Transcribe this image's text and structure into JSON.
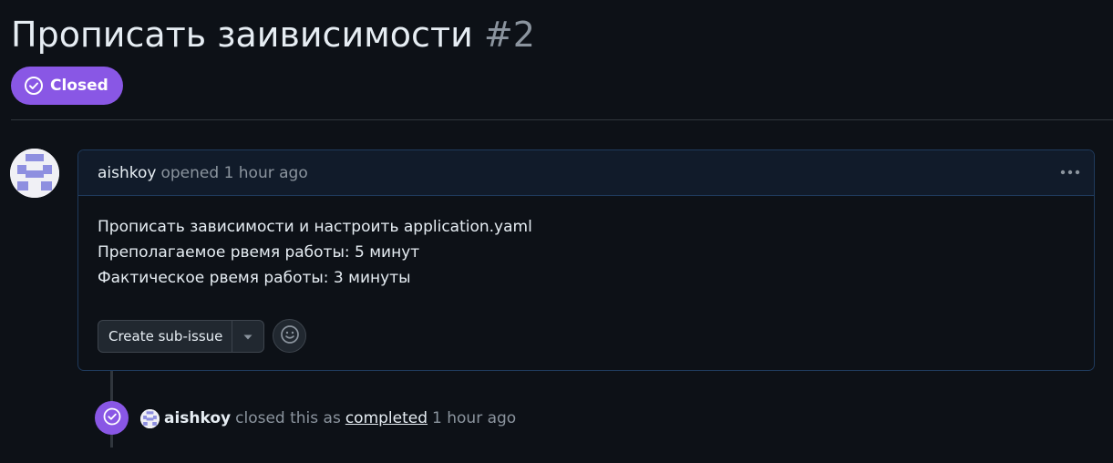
{
  "issue": {
    "title": "Прописать заивисимости",
    "number": "#2",
    "state": "Closed",
    "state_icon": "check-circle-icon",
    "state_color": "#8957e5"
  },
  "comment": {
    "author": "aishkoy",
    "meta": "opened 1 hour ago",
    "menu_icon": "kebab-horizontal-icon",
    "body": [
      "Прописать зависимости и настроить application.yaml",
      "Преполагаемое рвемя работы: 5 минут",
      "Фактическое рвемя работы: 3 минуты"
    ],
    "create_sub_issue_label": "Create sub-issue",
    "dropdown_icon": "triangle-down-icon",
    "reaction_icon": "smiley-icon"
  },
  "timeline_event": {
    "icon": "check-circle-icon",
    "author": "aishkoy",
    "text": "closed this as",
    "link": "completed",
    "time": "1 hour ago"
  },
  "colors": {
    "background": "#0d1117",
    "accent_purple": "#8957e5",
    "muted_text": "#8b949e",
    "comment_border": "#1f3a5c",
    "comment_header_bg": "#111b2a"
  }
}
